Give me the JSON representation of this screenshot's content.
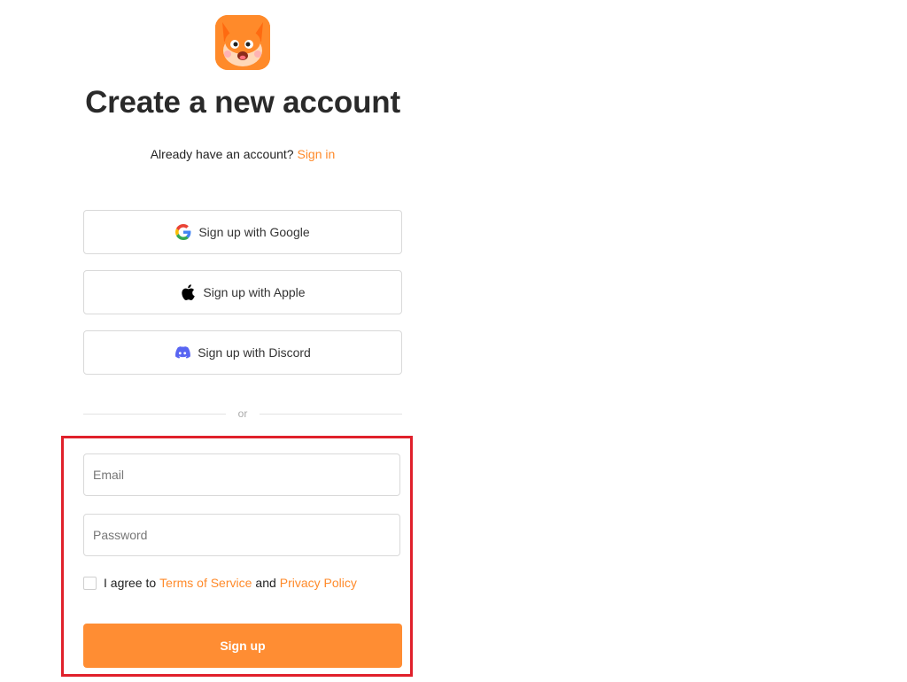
{
  "header": {
    "logo_icon": "fox-mascot-icon",
    "title": "Create a new account",
    "signin_prompt": "Already have an account?",
    "signin_link": "Sign in"
  },
  "oauth": {
    "google_label": "Sign up with Google",
    "apple_label": "Sign up with Apple",
    "discord_label": "Sign up with Discord"
  },
  "divider": {
    "text": "or"
  },
  "form": {
    "email_placeholder": "Email",
    "password_placeholder": "Password",
    "agree_prefix": "I agree to",
    "terms_link": "Terms of Service",
    "and_text": "and",
    "privacy_link": "Privacy Policy",
    "submit_label": "Sign up"
  },
  "colors": {
    "accent": "#ff8d33",
    "highlight_border": "#e0202b",
    "discord": "#5865f2"
  }
}
